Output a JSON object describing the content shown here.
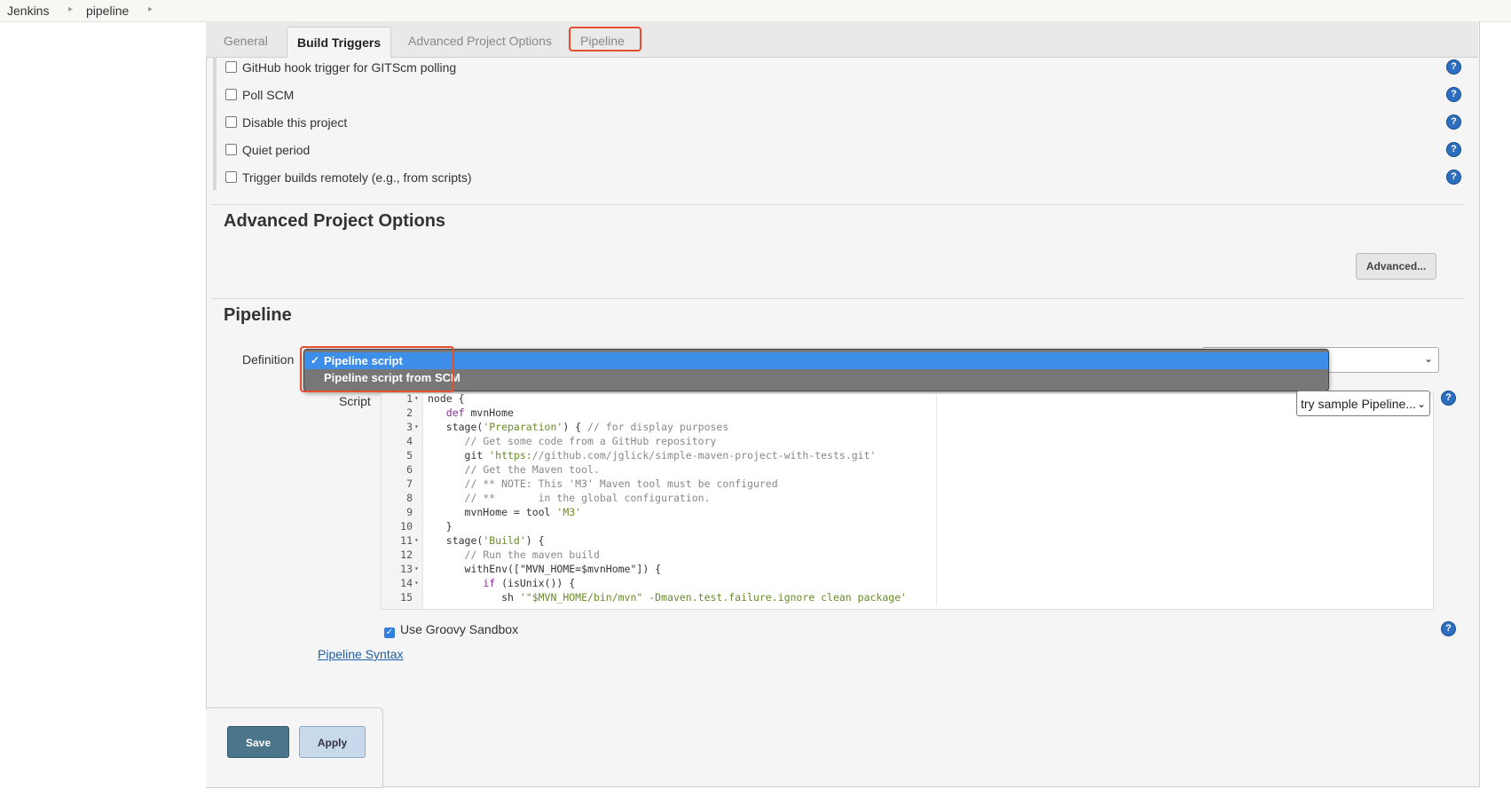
{
  "breadcrumb": {
    "items": [
      "Jenkins",
      "pipeline"
    ]
  },
  "tabs": [
    "General",
    "Build Triggers",
    "Advanced Project Options",
    "Pipeline"
  ],
  "triggers": [
    "GitHub hook trigger for GITScm polling",
    "Poll SCM",
    "Disable this project",
    "Quiet period",
    "Trigger builds remotely (e.g., from scripts)"
  ],
  "advanced_section": {
    "title": "Advanced Project Options",
    "button": "Advanced..."
  },
  "pipeline_section": {
    "title": "Pipeline",
    "definition_label": "Definition",
    "definition_options": [
      "Pipeline script",
      "Pipeline script from SCM"
    ],
    "script_label": "Script",
    "sample_select": "try sample Pipeline...",
    "sandbox_label": "Use Groovy Sandbox",
    "syntax_link": "Pipeline Syntax"
  },
  "code_lines": [
    "node {",
    "   def mvnHome",
    "   stage('Preparation') { // for display purposes",
    "      // Get some code from a GitHub repository",
    "      git 'https://github.com/jglick/simple-maven-project-with-tests.git'",
    "      // Get the Maven tool.",
    "      // ** NOTE: This 'M3' Maven tool must be configured",
    "      // **       in the global configuration.",
    "      mvnHome = tool 'M3'",
    "   }",
    "   stage('Build') {",
    "      // Run the maven build",
    "      withEnv([\"MVN_HOME=$mvnHome\"]) {",
    "         if (isUnix()) {",
    "            sh '\"$MVN_HOME/bin/mvn\" -Dmaven.test.failure.ignore clean package'"
  ],
  "buttons": {
    "save": "Save",
    "apply": "Apply"
  },
  "colors": {
    "highlight": "#e4502f",
    "selected_option": "#3d8ee8",
    "save_button": "#4b758b"
  }
}
